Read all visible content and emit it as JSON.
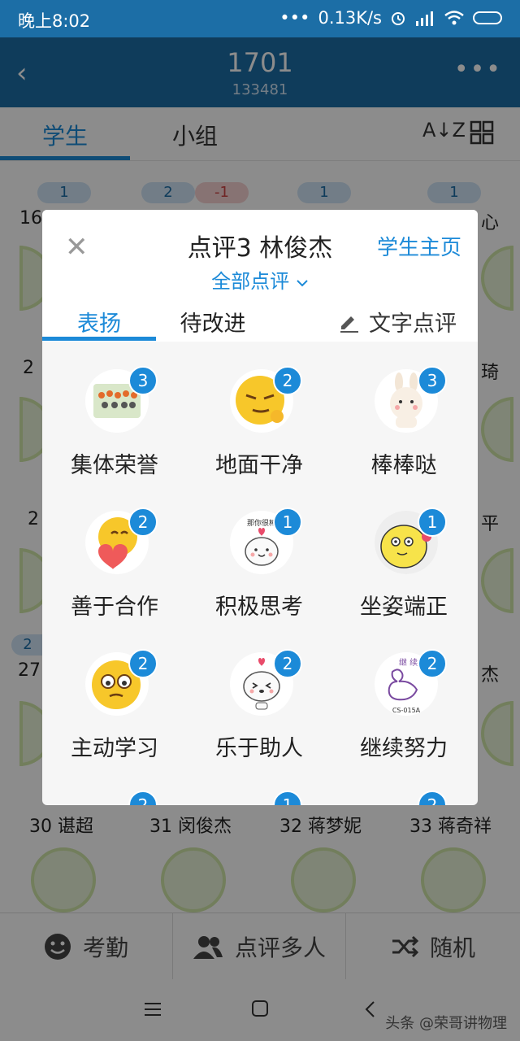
{
  "status_bar": {
    "time": "晚上8:02",
    "dots": "•••",
    "speed": "0.13K/s"
  },
  "header": {
    "title": "1701",
    "subtitle": "133481"
  },
  "tabs": {
    "students": "学生",
    "groups": "小组"
  },
  "bg_badges": [
    "1",
    "2",
    "-1",
    "1",
    "1",
    "2"
  ],
  "bg_names": {
    "r0a": "16",
    "r0b": "心",
    "r1a": "2",
    "r1b": "琦",
    "r2a": "2",
    "r2b": "平",
    "r3a": "27",
    "r3b": "杰",
    "row4": [
      "30 谌超",
      "31 闵俊杰",
      "32 蒋梦妮",
      "33 蒋奇祥"
    ]
  },
  "dialog": {
    "title": "点评3 林俊杰",
    "link": "学生主页",
    "filter": "全部点评",
    "tab_praise": "表扬",
    "tab_improve": "待改进",
    "tab_text": "文字点评",
    "items": [
      {
        "label": "集体荣誉",
        "count": "3"
      },
      {
        "label": "地面干净",
        "count": "2"
      },
      {
        "label": "棒棒哒",
        "count": "3"
      },
      {
        "label": "善于合作",
        "count": "2"
      },
      {
        "label": "积极思考",
        "count": "1"
      },
      {
        "label": "坐姿端正",
        "count": "1"
      },
      {
        "label": "主动学习",
        "count": "2"
      },
      {
        "label": "乐于助人",
        "count": "2"
      },
      {
        "label": "继续努力",
        "count": "2"
      }
    ],
    "partial_counts": [
      "2",
      "1",
      "2"
    ],
    "sticker_texts": {
      "praise": "那你很棒",
      "stamp_top": "继  续",
      "stamp_code": "CS-015A"
    }
  },
  "bottom_bar": {
    "attendance": "考勤",
    "multi_review": "点评多人",
    "random": "随机"
  },
  "watermark": "头条 @荣哥讲物理"
}
